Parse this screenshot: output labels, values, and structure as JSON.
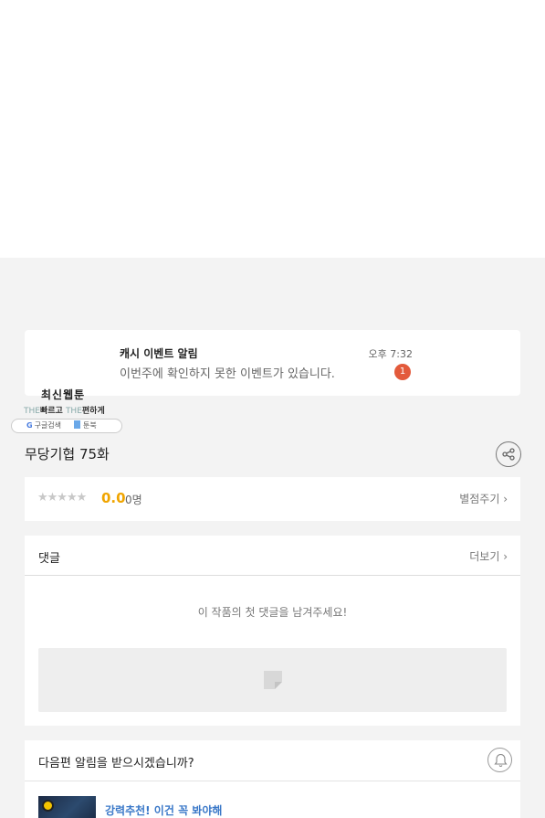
{
  "notification": {
    "title": "캐시 이벤트 알림",
    "body": "이번주에 확인하지 못한 이벤트가 있습니다.",
    "time": "오후 7:32",
    "badge_count": "1"
  },
  "brand": {
    "title": "최신웹툰",
    "tagline_the1": "THE",
    "tagline_fast": "빠르고",
    "tagline_the2": "THE",
    "tagline_easy": "편하게",
    "google_label": "구글검색",
    "toonbook_label": "툰북"
  },
  "episode": {
    "title": "무당기협 75화"
  },
  "rating": {
    "stars": "★★★★★",
    "score": "0.0",
    "votes": "0명",
    "rate_link": "별점주기 ›"
  },
  "comments": {
    "title": "댓글",
    "more_link": "더보기 ›",
    "empty_message": "이 작품의 첫 댓글을 남겨주세요!"
  },
  "alert": {
    "title": "다음편 알림을 받으시겠습니까?"
  },
  "recommendation": {
    "title": "강력추천! 이건 꼭 봐야해"
  },
  "colors": {
    "score": "#f0a500",
    "badge": "#e35a3b",
    "link_blue": "#3a78c8"
  }
}
